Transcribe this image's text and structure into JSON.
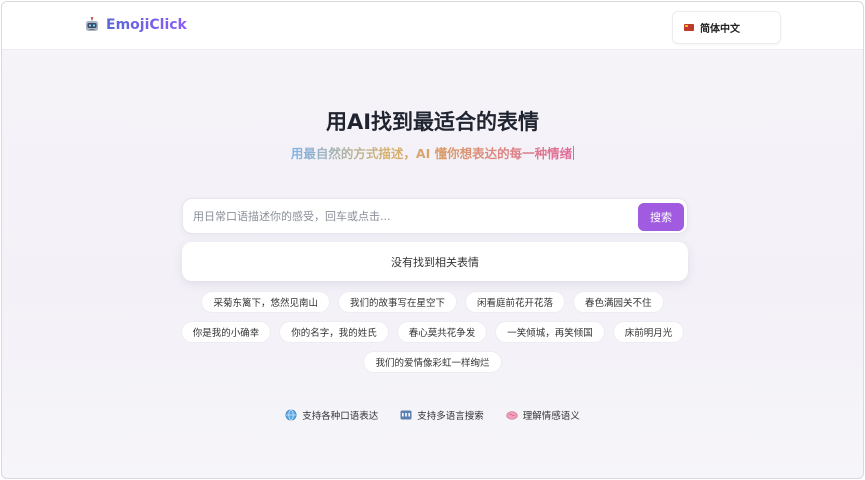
{
  "header": {
    "logo_text": "EmojiClick",
    "language": "简体中文"
  },
  "hero": {
    "title": "用AI找到最适合的表情",
    "subtitle": "用最自然的方式描述，AI 懂你想表达的每一种情绪"
  },
  "search": {
    "placeholder": "用日常口语描述你的感受，回车或点击...",
    "value": "",
    "button_label": "搜索"
  },
  "result": {
    "message": "没有找到相关表情"
  },
  "suggestions": [
    [
      "采菊东篱下，悠然见南山",
      "我们的故事写在星空下",
      "闲看庭前花开花落",
      "春色满园关不住"
    ],
    [
      "你是我的小确幸",
      "你的名字，我的姓氏",
      "春心莫共花争发",
      "一笑倾城，再笑倾国",
      "床前明月光"
    ],
    [
      "我们的爱情像彩虹一样绚烂"
    ]
  ],
  "features": [
    {
      "icon": "globe-icon",
      "label": "支持各种口语表达"
    },
    {
      "icon": "abc-icon",
      "label": "支持多语言搜索"
    },
    {
      "icon": "brain-icon",
      "label": "理解情感语义"
    }
  ],
  "colors": {
    "accent": "#a05be0",
    "logo_gradient_start": "#5a67d8",
    "logo_gradient_end": "#8b5cf6"
  }
}
